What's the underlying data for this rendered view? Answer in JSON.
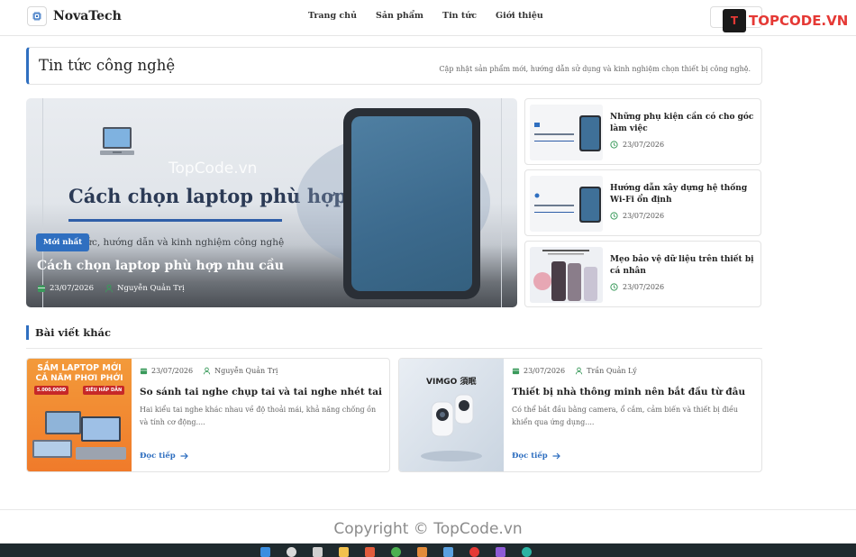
{
  "header": {
    "brand": "NovaTech",
    "nav": [
      "Trang chủ",
      "Sản phẩm",
      "Tin tức",
      "Giới thiệu"
    ],
    "topcode_logo": "TOPCODE.VN"
  },
  "page": {
    "title": "Tin tức công nghệ",
    "subtitle": "Cập nhật sản phẩm mới, hướng dẫn sử dụng và kinh nghiệm chọn thiết bị công nghệ."
  },
  "featured": {
    "badge": "Mới nhất",
    "image_heading": "Cách chọn laptop phù hợp nhu cầu",
    "image_sub": "tức, hướng dẫn và kinh nghiệm công nghệ",
    "title": "Cách chọn laptop phù hợp nhu cầu",
    "date": "23/07/2026",
    "author": "Nguyễn Quản Trị"
  },
  "side_posts": [
    {
      "title": "Những phụ kiện cần có cho góc làm việc",
      "date": "23/07/2026"
    },
    {
      "title": "Hướng dẫn xây dựng hệ thống Wi-Fi ổn định",
      "date": "23/07/2026"
    },
    {
      "title": "Mẹo bảo vệ dữ liệu trên thiết bị cá nhân",
      "date": "23/07/2026"
    }
  ],
  "other": {
    "heading": "Bài viết khác",
    "posts": [
      {
        "date": "23/07/2026",
        "author": "Nguyễn Quản Trị",
        "title": "So sánh tai nghe chụp tai và tai nghe nhét tai",
        "excerpt": "Hai kiểu tai nghe khác nhau về độ thoải mái, khả năng chống ồn và tính cơ động....",
        "more": "Đọc tiếp",
        "thumb_line1": "SẮM LAPTOP MỚI",
        "thumb_line2": "CẢ NĂM PHƠI PHỚI",
        "thumb_tag1": "5.000.000Đ",
        "thumb_tag2": "SIÊU HẤP DẪN"
      },
      {
        "date": "23/07/2026",
        "author": "Trần Quản Lý",
        "title": "Thiết bị nhà thông minh nên bắt đầu từ đâu",
        "excerpt": "Có thể bắt đầu bằng camera, ổ cắm, cảm biến và thiết bị điều khiển qua ứng dụng....",
        "more": "Đọc tiếp",
        "thumb_brand": "VIMGO 須眠"
      }
    ]
  },
  "footer": {
    "copyright": "Copyright © TopCode.vn"
  },
  "watermark": "TopCode.vn",
  "colors": {
    "accent": "#2f6fc0",
    "date_icon": "#3a9a5b"
  }
}
